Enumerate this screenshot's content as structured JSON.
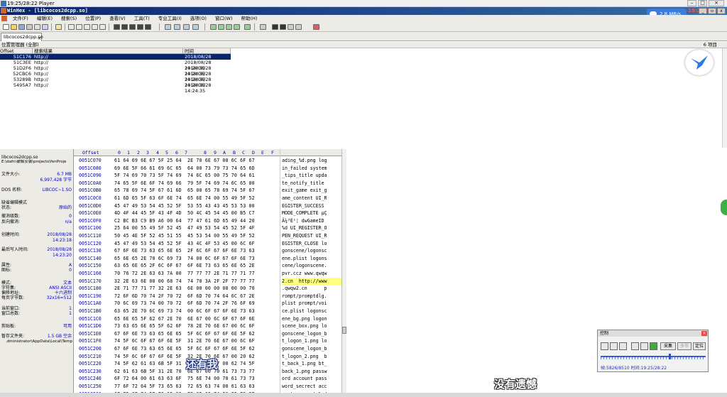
{
  "player": {
    "title": "19:25/28:22 Player"
  },
  "app": {
    "title": "WinHex - [libcocos2dcpp.so]"
  },
  "overlay": {
    "speed": "2.8 MB/s",
    "clock": "19:25/28:22"
  },
  "menu": [
    "文件(F)",
    "编辑(E)",
    "搜索(S)",
    "位置(P)",
    "查看(V)",
    "工具(T)",
    "专业工具(I)",
    "选项(O)",
    "窗口(W)",
    "帮助(H)"
  ],
  "tab": {
    "label": "libcocos2dcpp.so"
  },
  "position_manager": {
    "title": "位置管理器 (全部)",
    "count": "6 项目",
    "columns": [
      "Offset",
      "搜索结果",
      "时间"
    ],
    "rows": [
      {
        "offset": "51C176",
        "result": "http://",
        "time": "2018/08/28  14:24:35"
      },
      {
        "offset": "51C3EE",
        "result": "http://",
        "time": "2018/08/28  14:24:35"
      },
      {
        "offset": "51D2F6",
        "result": "http://",
        "time": "2018/08/28  14:24:35"
      },
      {
        "offset": "52CBC6",
        "result": "http://",
        "time": "2018/08/28  14:24:35"
      },
      {
        "offset": "53289B",
        "result": "http://",
        "time": "2018/08/28  14:24:35"
      },
      {
        "offset": "5495A7",
        "result": "http://",
        "time": "2018/08/28  14:24:35"
      }
    ]
  },
  "info": {
    "filename": "libcocos2dcpp.so",
    "path": "E:\\dafn\\破解安装\\projects\\fenProje",
    "size_label": "文件大小:",
    "size_mb": "6.7 MB",
    "size_bytes": "6,997,428 字节",
    "dos_label": "DOS 名称:",
    "dos_value": "LIBCOC~1.SO",
    "mode_label": "缺省编辑模式",
    "state_label": "状态:",
    "state_value": "原始的",
    "undo_label": "撤消级数:",
    "undo_value": "0",
    "redo_label": "反向撤消:",
    "redo_value": "n/a",
    "created_label": "创建时间:",
    "created_date": "2018/08/28",
    "created_time": "14:23:18",
    "written_label": "最后写入时间:",
    "written_date": "2018/08/28",
    "written_time": "14:23:20",
    "attr_label": "属性:",
    "attr_value": "A",
    "icon_label": "图标:",
    "icon_value": "0",
    "mode2_label": "模式:",
    "mode2_value": "文本",
    "charset_label": "字符集:",
    "charset_value": "ANSI ASCII",
    "offset_label": "偏移地址:",
    "offset_value": "十六进制",
    "perpage_label": "每页字节数:",
    "perpage_value": "32x16=512",
    "curwin_label": "当前窗口:",
    "curwin_value": "1",
    "totalwin_label": "窗口总数:",
    "totalwin_value": "1",
    "clip_label": "剪贴板:",
    "clip_value": "可用",
    "temp_label": "暂存文件夹:",
    "temp_value": "1.5 GB 空余",
    "temp_path": ".dministrator\\AppData\\Local\\Temp"
  },
  "hex": {
    "header_offset": "Offset",
    "columns": [
      "0",
      "1",
      "2",
      "3",
      "4",
      "5",
      "6",
      "7",
      "8",
      "9",
      "A",
      "B",
      "C",
      "D",
      "E",
      "F"
    ],
    "rows": [
      {
        "offset": "0051C070",
        "hex": "61 64 69 6E 67 5F 25 64  2E 70 6E 67 00 6C 6F 67",
        "text": "ading_%d.png log"
      },
      {
        "offset": "0051C080",
        "hex": "69 6E 5F 66 61 69 6C 65  64 00 73 79 73 74 65 6D",
        "text": "in_failed system"
      },
      {
        "offset": "0051C090",
        "hex": "5F 74 69 70 73 5F 74 69  74 6C 65 00 75 70 64 61",
        "text": "_tips_title upda"
      },
      {
        "offset": "0051C0A0",
        "hex": "74 65 5F 6E 6F 74 69 66  79 5F 74 69 74 6C 65 00",
        "text": "te_notify_title "
      },
      {
        "offset": "0051C0B0",
        "hex": "65 78 69 74 5F 67 61 6D  65 00 65 78 69 74 5F 67",
        "text": "exit_game exit_g"
      },
      {
        "offset": "0051C0C0",
        "hex": "61 6D 65 5F 63 6F 6E 74  65 6E 74 00 55 49 5F 52",
        "text": "ame_content UI_R"
      },
      {
        "offset": "0051C0D0",
        "hex": "45 47 49 53 54 45 52 5F  53 55 43 43 45 53 53 00",
        "text": "EGISTER_SUCCESS "
      },
      {
        "offset": "0051C0E0",
        "hex": "4D 4F 44 45 5F 43 4F 4D  50 4C 45 54 45 00 B5 C7",
        "text": "MODE_COMPLETE µÇ"
      },
      {
        "offset": "0051C0F0",
        "hex": "C2 BC B3 C9 B9 A6 00 64  77 47 61 6D 65 49 44 20",
        "text": "Â¼³É¹¦ dwGameID "
      },
      {
        "offset": "0051C100",
        "hex": "25 64 00 55 49 5F 52 45  47 49 53 54 45 52 5F 4F",
        "text": "%d UI_REGISTER_O"
      },
      {
        "offset": "0051C110",
        "hex": "50 45 4E 5F 52 45 51 55  45 53 54 00 55 49 5F 52",
        "text": "PEN_REQUEST UI_R"
      },
      {
        "offset": "0051C120",
        "hex": "45 47 49 53 54 45 52 5F  43 4C 4F 53 45 00 6C 6F",
        "text": "EGISTER_CLOSE lo"
      },
      {
        "offset": "0051C130",
        "hex": "67 6F 6E 73 63 65 6E 65  2F 6C 6F 67 6F 6E 73 63",
        "text": "gonscene/logonsc"
      },
      {
        "offset": "0051C140",
        "hex": "65 6E 65 2E 70 6C 69 73  74 00 6C 6F 67 6F 6E 73",
        "text": "ene.plist logons"
      },
      {
        "offset": "0051C150",
        "hex": "63 65 6E 65 2F 6C 6F 67  6F 6E 73 63 65 6E 65 2E",
        "text": "cene/logonscene."
      },
      {
        "offset": "0051C160",
        "hex": "70 76 72 2E 63 63 7A 00  77 77 77 2E 71 77 71 77",
        "text": "pvr.ccz www.qwqw"
      },
      {
        "offset": "0051C170",
        "hex": "32 2E 63 6E 00 00 68 74  74 70 3A 2F 2F 77 77 77",
        "text": "2.cn  http://www",
        "hl": true
      },
      {
        "offset": "0051C180",
        "hex": "2E 71 77 71 77 32 2E 63  6E 00 00 00 00 00 00 70",
        "text": ".qwqw2.cn      p"
      },
      {
        "offset": "0051C190",
        "hex": "72 6F 6D 70 74 2F 70 72  6F 6D 70 74 64 6C 67 2E",
        "text": "rompt/promptdlg."
      },
      {
        "offset": "0051C1A0",
        "hex": "70 6C 69 73 74 00 70 72  6F 6D 70 74 2F 76 6F 69",
        "text": "plist prompt/voi"
      },
      {
        "offset": "0051C1B0",
        "hex": "63 65 2E 70 6C 69 73 74  00 6C 6F 67 6F 6E 73 63",
        "text": "ce.plist logonsc"
      },
      {
        "offset": "0051C1C0",
        "hex": "65 6E 65 5F 62 67 2E 70  6E 67 00 6C 6F 67 6F 6E",
        "text": "ene_bg.png logon"
      },
      {
        "offset": "0051C1D0",
        "hex": "73 63 65 6E 65 5F 62 6F  78 2E 70 6E 67 00 6C 6F",
        "text": "scene_box.png lo"
      },
      {
        "offset": "0051C1E0",
        "hex": "67 6F 6E 73 63 65 6E 65  5F 6C 6F 67 6F 6E 5F 62",
        "text": "gonscene_logon_b"
      },
      {
        "offset": "0051C1F0",
        "hex": "74 5F 6C 6F 67 6F 6E 5F  31 2E 70 6E 67 00 6C 6F",
        "text": "t_logon_1.png lo"
      },
      {
        "offset": "0051C200",
        "hex": "67 6F 6E 73 63 65 6E 65  5F 6C 6F 67 6F 6E 5F 62",
        "text": "gonscene_logon_b"
      },
      {
        "offset": "0051C210",
        "hex": "74 5F 6C 6F 67 6F 6E 5F  32 2E 70 6E 67 00 20 62",
        "text": "t_logon_2.png  b"
      },
      {
        "offset": "0051C220",
        "hex": "74 5F 62 61 63 6B 5F 31  2E 70 6E 67 00 62 74 5F",
        "text": "t_back_1.png bt_"
      },
      {
        "offset": "0051C230",
        "hex": "62 61 63 6B 5F 31 2E 70  6E 67 00 70 61 73 73 77",
        "text": "back_1.png passw"
      },
      {
        "offset": "0051C240",
        "hex": "6F 72 64 00 61 63 63 6F  75 6E 74 00 70 61 73 73",
        "text": "ord account pass"
      },
      {
        "offset": "0051C250",
        "hex": "77 6F 72 64 5F 73 65 63  72 65 63 74 00 61 63 63",
        "text": "word_secrect acc"
      },
      {
        "offset": "0051C260",
        "hex": "6F 75 6E 74 5F 73 65 63  72 65 63 74 20 25 73 2F",
        "text": "ount_secrect %s/"
      }
    ]
  },
  "control": {
    "title": "控制",
    "btn_capture": "采集",
    "btn_multi": "多节",
    "btn_locate": "定位",
    "status": "帧:5826/8510 时间:19:25/28:22"
  },
  "subtitles": {
    "left": "还有我",
    "right": "没有遗憾"
  }
}
